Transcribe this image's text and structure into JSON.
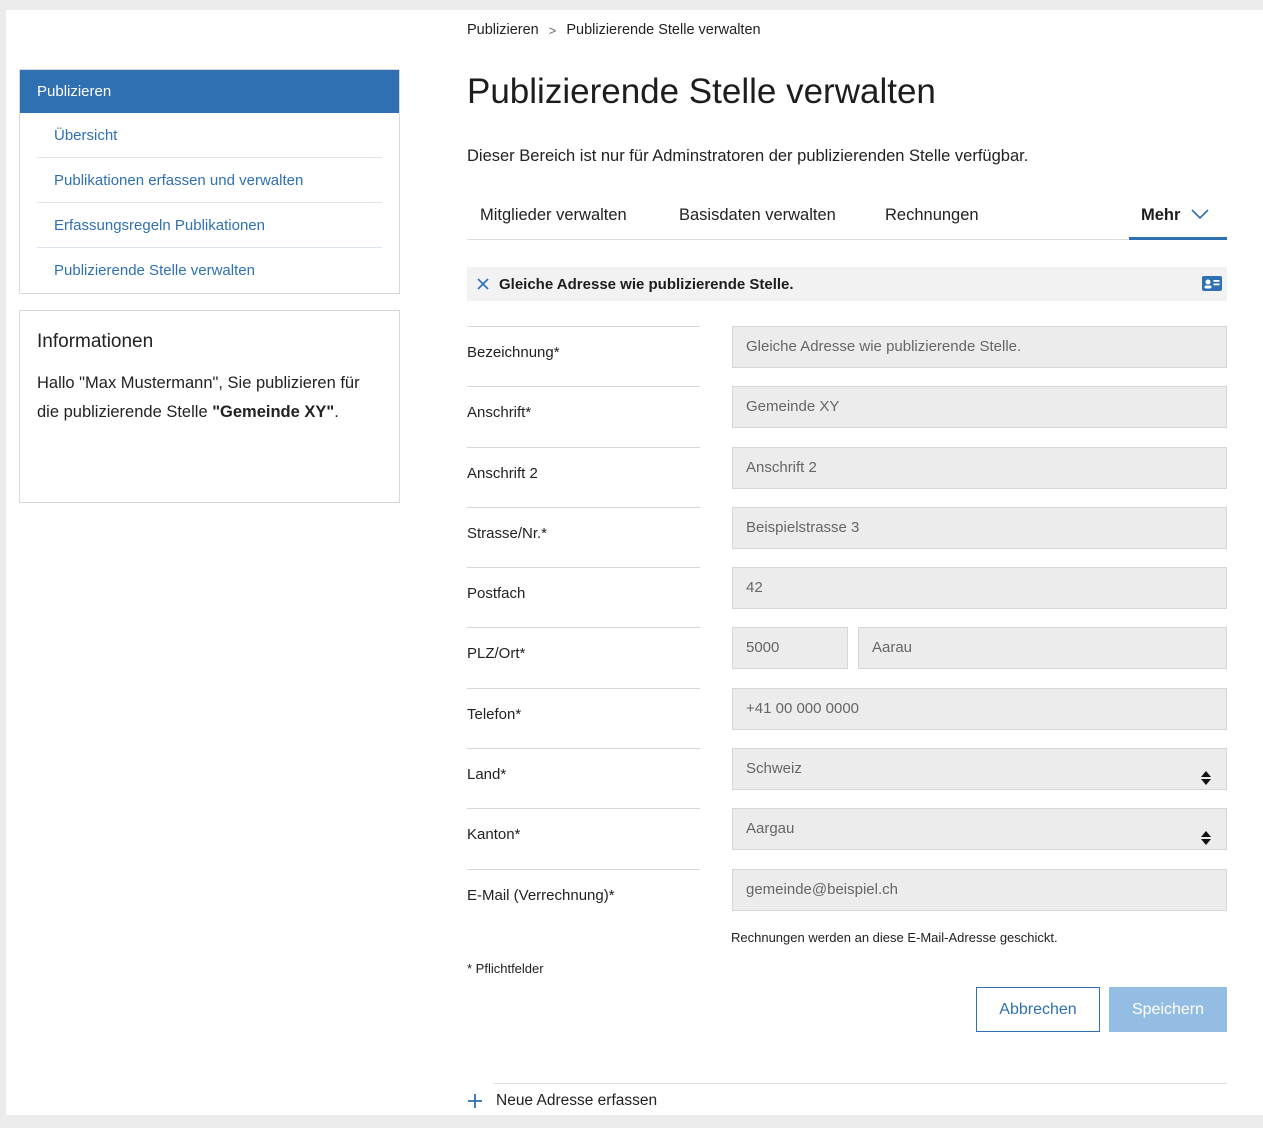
{
  "breadcrumb": {
    "items": [
      "Publizieren",
      "Publizierende Stelle verwalten"
    ],
    "separator": ">"
  },
  "sidebar": {
    "header": "Publizieren",
    "items": [
      {
        "label": "Übersicht"
      },
      {
        "label": "Publikationen erfassen und verwalten"
      },
      {
        "label": "Erfassungsregeln Publikationen"
      },
      {
        "label": "Publizierende Stelle verwalten"
      }
    ]
  },
  "info": {
    "title": "Informationen",
    "text_prefix": "Hallo \"Max Mustermann\", Sie publizieren für die publizierende Stelle ",
    "org_name": "\"Gemeinde XY\"",
    "text_suffix": "."
  },
  "main": {
    "title": "Publizierende Stelle verwalten",
    "intro": "Dieser Bereich ist nur für Adminstratoren der publizierenden Stelle verfügbar.",
    "tabs": [
      {
        "label": "Mitglieder verwalten"
      },
      {
        "label": "Basisdaten verwalten"
      },
      {
        "label": "Rechnungen"
      }
    ],
    "more_label": "Mehr",
    "address_title": "Gleiche Adresse wie publizierende Stelle."
  },
  "form": {
    "bezeichnung": {
      "label": "Bezeichnung*",
      "value": "Gleiche Adresse wie publizierende Stelle."
    },
    "anschrift": {
      "label": "Anschrift*",
      "value": "Gemeinde XY"
    },
    "anschrift2": {
      "label": "Anschrift 2",
      "value": "Anschrift 2"
    },
    "strasse": {
      "label": "Strasse/Nr.*",
      "value": "Beispielstrasse 3"
    },
    "postfach": {
      "label": "Postfach",
      "value": "42"
    },
    "plz_ort": {
      "label": "PLZ/Ort*",
      "plz": "5000",
      "ort": "Aarau"
    },
    "telefon": {
      "label": "Telefon*",
      "value": "+41 00 000 0000"
    },
    "land": {
      "label": "Land*",
      "value": "Schweiz"
    },
    "kanton": {
      "label": "Kanton*",
      "value": "Aargau"
    },
    "email": {
      "label": "E-Mail (Verrechnung)*",
      "value": "gemeinde@beispiel.ch"
    },
    "email_hint": "Rechnungen werden an diese E-Mail-Adresse geschickt.",
    "required_note": "* Pflichtfelder"
  },
  "actions": {
    "cancel_label": "Abbrechen",
    "save_label": "Speichern"
  },
  "new_address_label": "Neue Adresse erfassen",
  "colors": {
    "accent": "#2f70b3",
    "save_disabled": "#93bde3",
    "field_bg": "#ececec"
  }
}
